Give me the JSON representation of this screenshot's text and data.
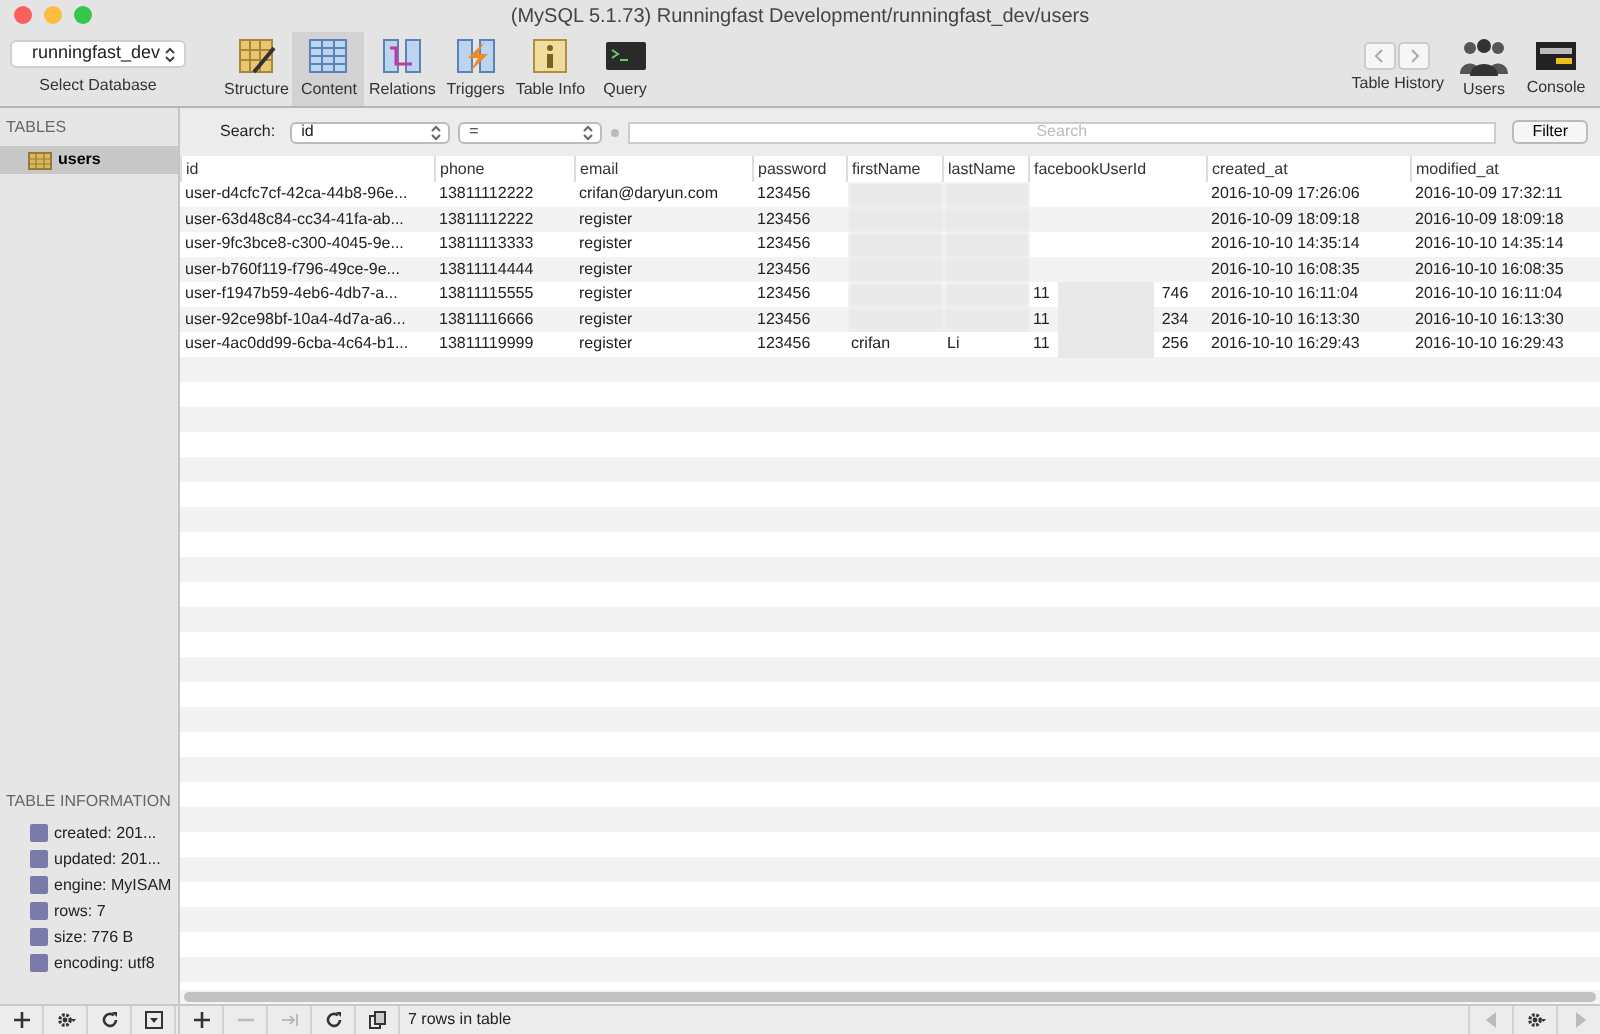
{
  "window": {
    "title": "(MySQL 5.1.73) Runningfast Development/runningfast_dev/users"
  },
  "toolbar": {
    "database": {
      "value": "runningfast_dev",
      "label": "Select Database"
    },
    "tools": [
      {
        "label": "Structure",
        "kind": "structure",
        "selected": false
      },
      {
        "label": "Content",
        "kind": "content",
        "selected": true
      },
      {
        "label": "Relations",
        "kind": "relations",
        "selected": false
      },
      {
        "label": "Triggers",
        "kind": "triggers",
        "selected": false
      },
      {
        "label": "Table Info",
        "kind": "info",
        "selected": false
      },
      {
        "label": "Query",
        "kind": "query",
        "selected": false
      }
    ],
    "right": [
      {
        "label": "Table History",
        "kind": "history"
      },
      {
        "label": "Users",
        "kind": "users"
      },
      {
        "label": "Console",
        "kind": "console"
      }
    ]
  },
  "sidebar": {
    "tables_heading": "TABLES",
    "tables": [
      {
        "name": "users",
        "selected": true
      }
    ],
    "info_heading": "TABLE INFORMATION",
    "info": [
      "created: 201...",
      "updated: 201...",
      "engine: MyISAM",
      "rows: 7",
      "size: 776 B",
      "encoding: utf8"
    ]
  },
  "search": {
    "label": "Search:",
    "field": "id",
    "operator": "=",
    "placeholder": "Search",
    "button": "Filter"
  },
  "table": {
    "columns": [
      "id",
      "phone",
      "email",
      "password",
      "firstName",
      "lastName",
      "facebookUserId",
      "created_at",
      "modified_at"
    ],
    "rows": [
      {
        "id": "user-d4cfc7cf-42ca-44b8-96e...",
        "phone": "13811112222",
        "email": "crifan@daryun.com",
        "password": "123456",
        "name_blurred": true,
        "created_at": "2016-10-09 17:26:06",
        "modified_at": "2016-10-09 17:32:11"
      },
      {
        "id": "user-63d48c84-cc34-41fa-ab...",
        "phone": "13811112222",
        "email": "register",
        "password": "123456",
        "name_blurred": true,
        "created_at": "2016-10-09 18:09:18",
        "modified_at": "2016-10-09 18:09:18"
      },
      {
        "id": "user-9fc3bce8-c300-4045-9e...",
        "phone": "13811113333",
        "email": "register",
        "password": "123456",
        "name_blurred": true,
        "created_at": "2016-10-10 14:35:14",
        "modified_at": "2016-10-10 14:35:14"
      },
      {
        "id": "user-b760f119-f796-49ce-9e...",
        "phone": "13811114444",
        "email": "register",
        "password": "123456",
        "name_blurred": true,
        "created_at": "2016-10-10 16:08:35",
        "modified_at": "2016-10-10 16:08:35"
      },
      {
        "id": "user-f1947b59-4eb6-4db7-a...",
        "phone": "13811115555",
        "email": "register",
        "password": "123456",
        "name_blurred": true,
        "facebook_start": "11",
        "facebook_end": "746",
        "facebook_blurred": true,
        "created_at": "2016-10-10 16:11:04",
        "modified_at": "2016-10-10 16:11:04"
      },
      {
        "id": "user-92ce98bf-10a4-4d7a-a6...",
        "phone": "13811116666",
        "email": "register",
        "password": "123456",
        "name_blurred": true,
        "facebook_start": "11",
        "facebook_end": "234",
        "facebook_blurred": true,
        "created_at": "2016-10-10 16:13:30",
        "modified_at": "2016-10-10 16:13:30"
      },
      {
        "id": "user-4ac0dd99-6cba-4c64-b1...",
        "phone": "13811119999",
        "email": "register",
        "password": "123456",
        "firstName": "crifan",
        "lastName": "Li",
        "facebook_start": "11",
        "facebook_end": "256",
        "facebook_blurred": true,
        "created_at": "2016-10-10 16:29:43",
        "modified_at": "2016-10-10 16:29:43"
      }
    ]
  },
  "bottom_bar": {
    "sidebar_buttons": [
      {
        "kind": "add",
        "disabled": false
      },
      {
        "kind": "gear",
        "disabled": false
      },
      {
        "kind": "refresh",
        "disabled": false
      },
      {
        "kind": "filter",
        "disabled": false
      }
    ],
    "content_buttons": [
      {
        "kind": "add",
        "disabled": false
      },
      {
        "kind": "remove",
        "disabled": true
      },
      {
        "kind": "duplicate",
        "disabled": true
      },
      {
        "kind": "refresh",
        "disabled": false
      },
      {
        "kind": "copy",
        "disabled": false
      }
    ],
    "status": "7 rows in table",
    "pager_buttons": [
      {
        "kind": "prev",
        "disabled": true
      },
      {
        "kind": "gear",
        "disabled": false
      },
      {
        "kind": "next",
        "disabled": true
      }
    ]
  }
}
